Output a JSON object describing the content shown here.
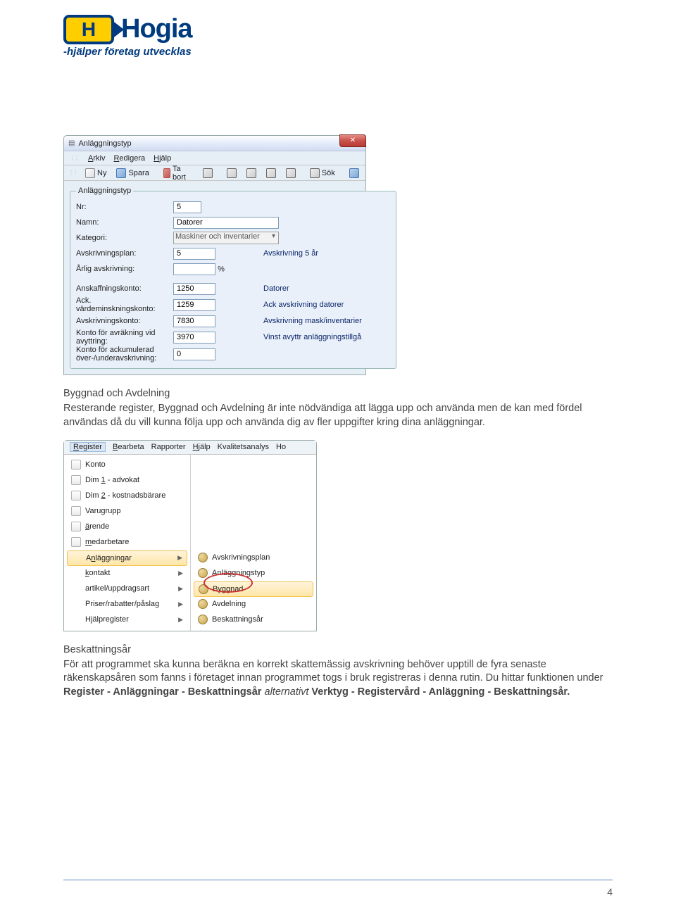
{
  "logo": {
    "brand": "Hogia",
    "tagline": "-hjälper företag utvecklas"
  },
  "screenshot1": {
    "title": "Anläggningstyp",
    "menu": [
      "Arkiv",
      "Redigera",
      "Hjälp"
    ],
    "toolbar": {
      "ny": "Ny",
      "spara": "Spara",
      "tabort": "Ta bort",
      "sok": "Sök"
    },
    "legend": "Anläggningstyp",
    "fields": {
      "nr_label": "Nr:",
      "nr_value": "5",
      "namn_label": "Namn:",
      "namn_value": "Datorer",
      "kategori_label": "Kategori:",
      "kategori_value": "Maskiner och inventarier",
      "avplan_label": "Avskrivningsplan:",
      "avplan_value": "5",
      "avplan_desc": "Avskrivning 5 år",
      "arlig_label": "Årlig avskrivning:",
      "arlig_suffix": "%",
      "anskaff_label": "Anskaffningskonto:",
      "anskaff_value": "1250",
      "anskaff_desc": "Datorer",
      "ack_label": "Ack. värdeminskningskonto:",
      "ack_value": "1259",
      "ack_desc": "Ack avskrivning datorer",
      "avskriv_label": "Avskrivningskonto:",
      "avskriv_value": "7830",
      "avskriv_desc": "Avskrivning mask/inventarier",
      "avrak_label": "Konto för avräkning vid avyttring:",
      "avrak_value": "3970",
      "avrak_desc": "Vinst avyttr anläggningstillgå",
      "ackum_label": "Konto för ackumulerad över-/underavskrivning:",
      "ackum_value": "0"
    }
  },
  "section1": {
    "heading": "Byggnad och Avdelning",
    "body": "Resterande register, Byggnad och Avdelning är inte nödvändiga att lägga upp och använda men de kan med fördel användas då du vill kunna följa upp och använda dig av fler uppgifter kring dina anläggningar."
  },
  "screenshot2": {
    "menu": [
      "Register",
      "Bearbeta",
      "Rapporter",
      "Hjälp",
      "Kvalitetsanalys",
      "Ho"
    ],
    "left_items": [
      {
        "label": "Konto",
        "sub": false
      },
      {
        "label": "Dim 1 - advokat",
        "sub": false
      },
      {
        "label": "Dim 2 - kostnadsbärare",
        "sub": false
      },
      {
        "label": "Varugrupp",
        "sub": false
      },
      {
        "label": "ärende",
        "sub": false
      },
      {
        "label": "medarbetare",
        "sub": false
      },
      {
        "label": "Anläggningar",
        "sub": true,
        "hl": true
      },
      {
        "label": "kontakt",
        "sub": true
      },
      {
        "label": "artikel/uppdragsart",
        "sub": true
      },
      {
        "label": "Priser/rabatter/påslag",
        "sub": true
      },
      {
        "label": "Hjälpregister",
        "sub": true
      }
    ],
    "right_items": [
      {
        "label": "Avskrivningsplan"
      },
      {
        "label": "Anläggningstyp"
      },
      {
        "label": "Byggnad",
        "hl": true
      },
      {
        "label": "Avdelning"
      },
      {
        "label": "Beskattningsår"
      }
    ]
  },
  "section2": {
    "heading": "Beskattningsår",
    "body_plain_1": "För att programmet ska kunna beräkna en korrekt skattemässig avskrivning behöver upptill de fyra senaste räkenskapsåren som fanns i företaget innan programmet togs i bruk registreras i denna rutin. Du hittar funktionen under ",
    "strong1": "Register - Anläggningar - Beskattningsår",
    "mid": " alternativt ",
    "strong2": "Verktyg - Registervård - Anläggning - Beskattningsår."
  },
  "page_number": "4"
}
